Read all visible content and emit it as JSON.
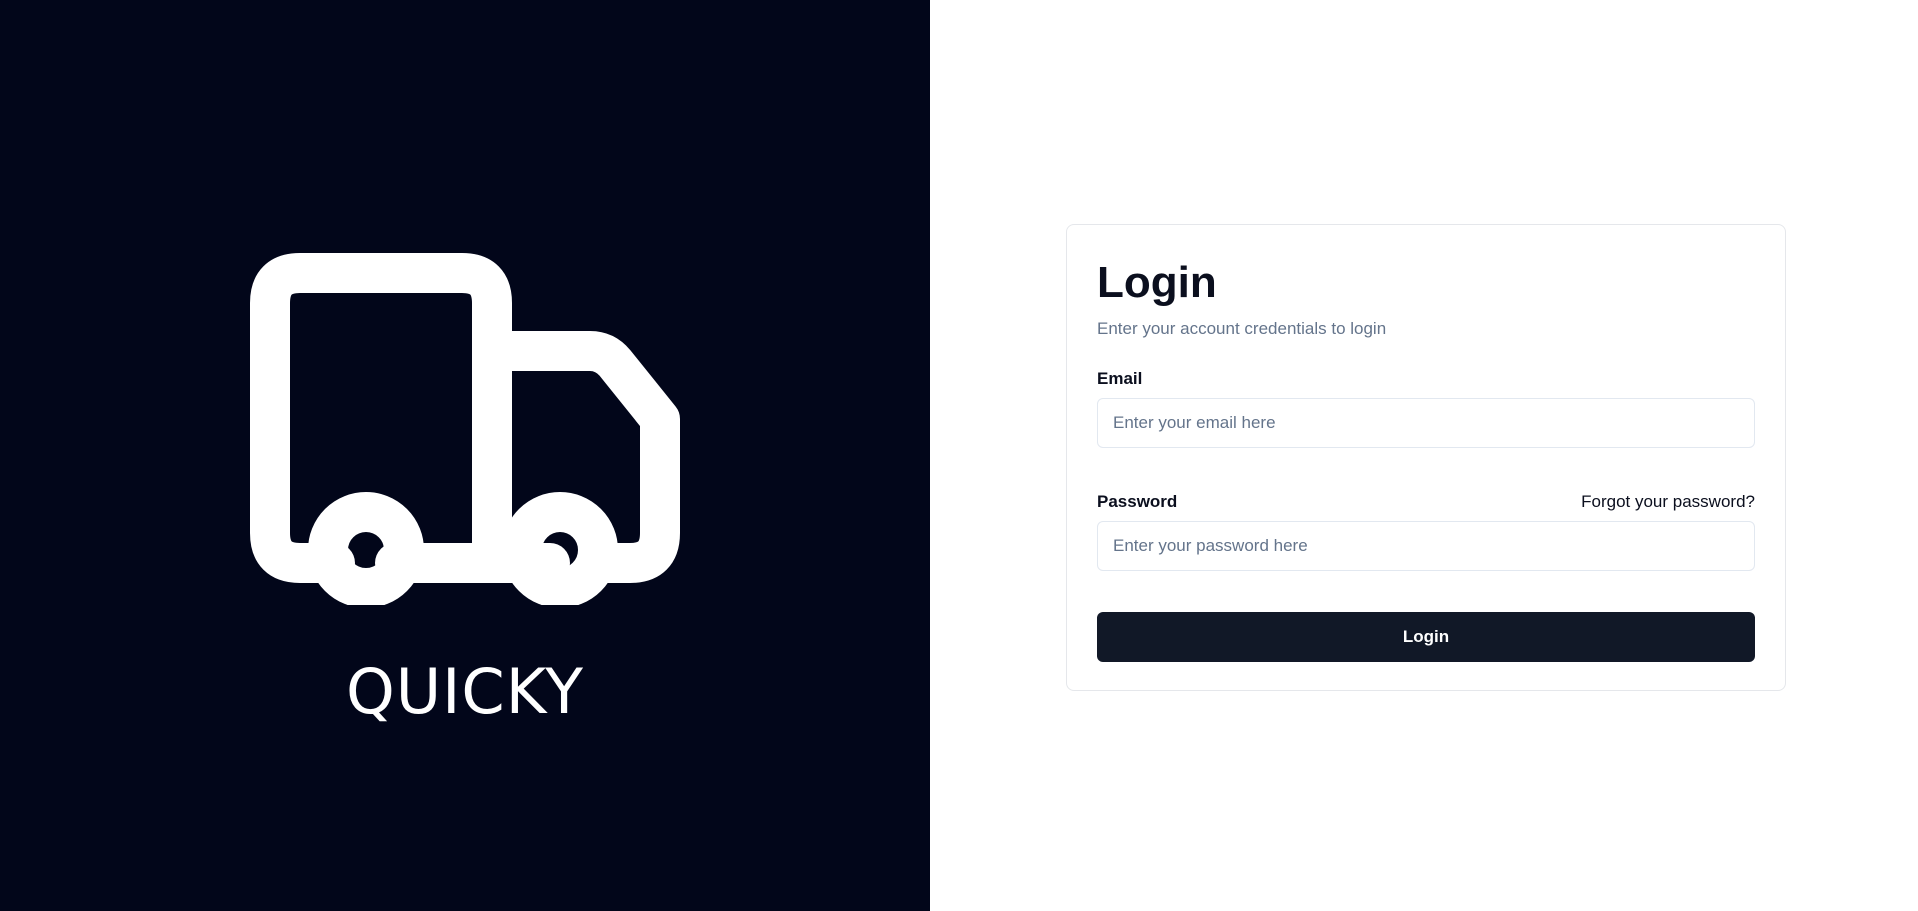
{
  "brand": {
    "name": "QUICKY",
    "icon": "truck-icon",
    "panel_color": "#02061a"
  },
  "login": {
    "title": "Login",
    "subtitle": "Enter your account credentials to login",
    "email_label": "Email",
    "email_placeholder": "Enter your email here",
    "email_value": "",
    "password_label": "Password",
    "password_placeholder": "Enter your password here",
    "password_value": "",
    "forgot_link": "Forgot your password?",
    "submit_label": "Login",
    "button_color": "#111827"
  }
}
